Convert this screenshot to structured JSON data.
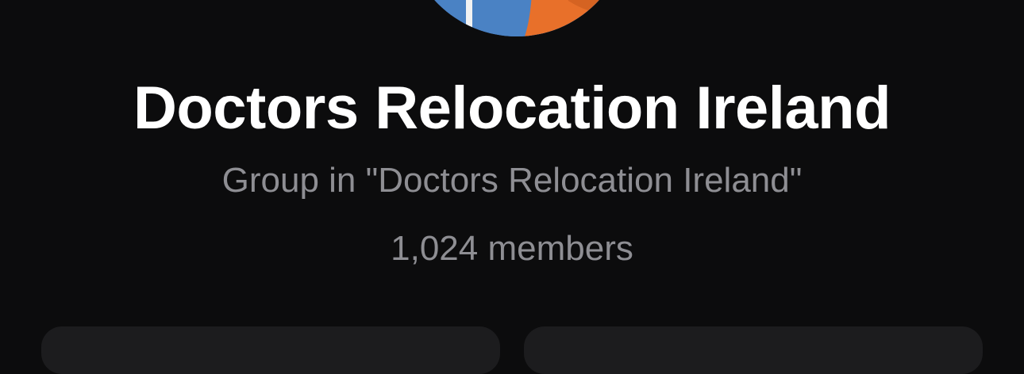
{
  "group": {
    "title": "Doctors Relocation Ireland",
    "subtitle": "Group in \"Doctors Relocation Ireland\"",
    "members": "1,024 members"
  },
  "avatar": {
    "icon": "group-avatar-photo",
    "colors": {
      "sky": "#4a82c4",
      "flag": "#e8702a",
      "pole": "#f2f2f2"
    }
  },
  "colors": {
    "background": "#0c0c0d",
    "title": "#ffffff",
    "secondary_text": "#8e8e93",
    "card": "#1c1c1e"
  }
}
